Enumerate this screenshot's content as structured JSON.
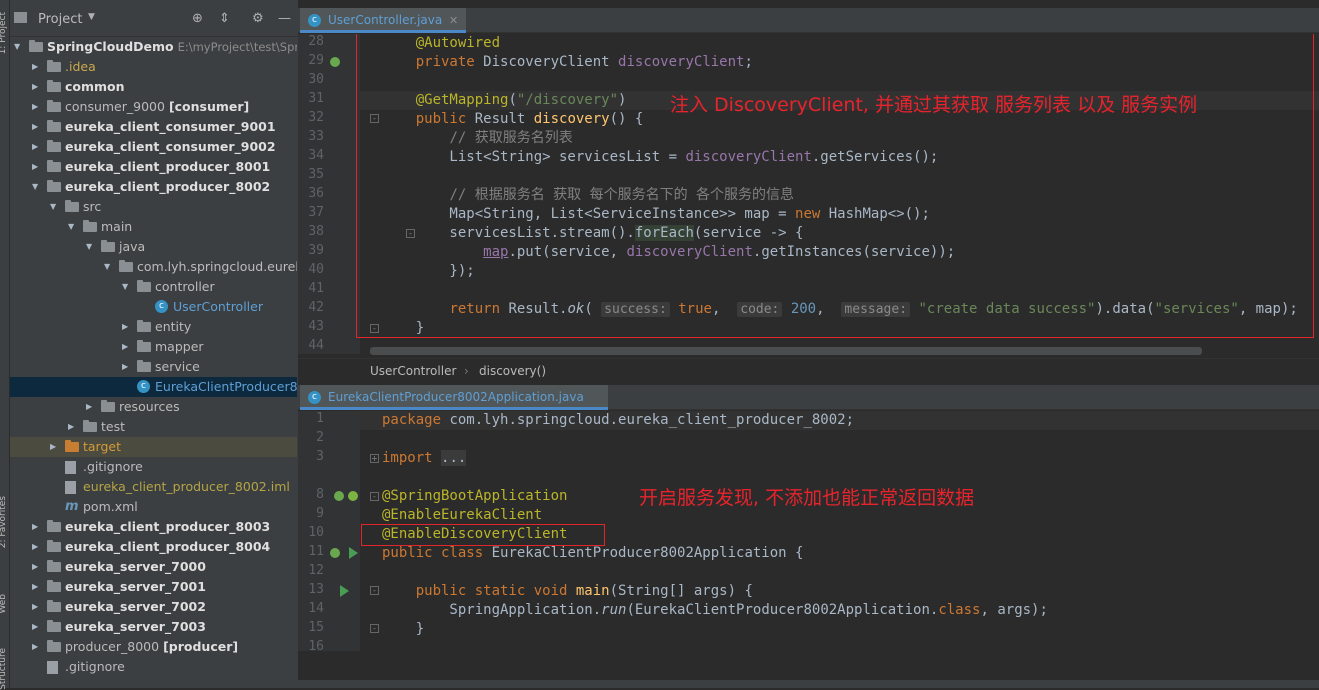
{
  "left_strip": {
    "tabs": [
      "1: Project",
      "2: Favorites",
      "Web",
      "Structure"
    ]
  },
  "project_panel": {
    "title": "Project",
    "tree": [
      {
        "indent": 0,
        "arrow": "▼",
        "icon": "folder",
        "label": "SpringCloudDemo",
        "extra": "E:\\myProject\\test\\Sprin",
        "style": "bold"
      },
      {
        "indent": 1,
        "arrow": "▶",
        "icon": "folder",
        "label": ".idea",
        "style": "idea"
      },
      {
        "indent": 1,
        "arrow": "▶",
        "icon": "folder",
        "label": "common",
        "style": "bold"
      },
      {
        "indent": 1,
        "arrow": "▶",
        "icon": "folder",
        "label": "consumer_9000",
        "tag": "[consumer]",
        "style": "normal"
      },
      {
        "indent": 1,
        "arrow": "▶",
        "icon": "folder",
        "label": "eureka_client_consumer_9001",
        "style": "bold"
      },
      {
        "indent": 1,
        "arrow": "▶",
        "icon": "folder",
        "label": "eureka_client_consumer_9002",
        "style": "bold"
      },
      {
        "indent": 1,
        "arrow": "▶",
        "icon": "folder",
        "label": "eureka_client_producer_8001",
        "style": "bold"
      },
      {
        "indent": 1,
        "arrow": "▼",
        "icon": "folder",
        "label": "eureka_client_producer_8002",
        "style": "bold"
      },
      {
        "indent": 2,
        "arrow": "▼",
        "icon": "folder",
        "label": "src",
        "style": "normal"
      },
      {
        "indent": 3,
        "arrow": "▼",
        "icon": "folder",
        "label": "main",
        "style": "normal"
      },
      {
        "indent": 4,
        "arrow": "▼",
        "icon": "folder",
        "label": "java",
        "style": "normal"
      },
      {
        "indent": 5,
        "arrow": "▼",
        "icon": "folder",
        "label": "com.lyh.springcloud.eureka_",
        "style": "normal"
      },
      {
        "indent": 6,
        "arrow": "▼",
        "icon": "folder",
        "label": "controller",
        "style": "normal"
      },
      {
        "indent": 7,
        "arrow": "",
        "icon": "class",
        "label": "UserController",
        "style": "blue"
      },
      {
        "indent": 6,
        "arrow": "▶",
        "icon": "folder",
        "label": "entity",
        "style": "normal"
      },
      {
        "indent": 6,
        "arrow": "▶",
        "icon": "folder",
        "label": "mapper",
        "style": "normal"
      },
      {
        "indent": 6,
        "arrow": "▶",
        "icon": "folder",
        "label": "service",
        "style": "normal"
      },
      {
        "indent": 6,
        "arrow": "",
        "icon": "class",
        "label": "EurekaClientProducer800",
        "style": "blue",
        "selected": true
      },
      {
        "indent": 4,
        "arrow": "▶",
        "icon": "folder",
        "label": "resources",
        "style": "normal"
      },
      {
        "indent": 3,
        "arrow": "▶",
        "icon": "folder",
        "label": "test",
        "style": "normal"
      },
      {
        "indent": 2,
        "arrow": "▶",
        "icon": "folder-orange",
        "label": "target",
        "style": "orange",
        "gray": true
      },
      {
        "indent": 2,
        "arrow": "",
        "icon": "file",
        "label": ".gitignore",
        "style": "normal"
      },
      {
        "indent": 2,
        "arrow": "",
        "icon": "file",
        "label": "eureka_client_producer_8002.iml",
        "style": "yellow"
      },
      {
        "indent": 2,
        "arrow": "",
        "icon": "maven",
        "label": "pom.xml",
        "style": "normal"
      },
      {
        "indent": 1,
        "arrow": "▶",
        "icon": "folder",
        "label": "eureka_client_producer_8003",
        "style": "bold"
      },
      {
        "indent": 1,
        "arrow": "▶",
        "icon": "folder",
        "label": "eureka_client_producer_8004",
        "style": "bold"
      },
      {
        "indent": 1,
        "arrow": "▶",
        "icon": "folder",
        "label": "eureka_server_7000",
        "style": "bold"
      },
      {
        "indent": 1,
        "arrow": "▶",
        "icon": "folder",
        "label": "eureka_server_7001",
        "style": "bold"
      },
      {
        "indent": 1,
        "arrow": "▶",
        "icon": "folder",
        "label": "eureka_server_7002",
        "style": "bold"
      },
      {
        "indent": 1,
        "arrow": "▶",
        "icon": "folder",
        "label": "eureka_server_7003",
        "style": "bold"
      },
      {
        "indent": 1,
        "arrow": "▶",
        "icon": "folder",
        "label": "producer_8000",
        "tag": "[producer]",
        "style": "normal"
      },
      {
        "indent": 1,
        "arrow": "",
        "icon": "file",
        "label": ".gitignore",
        "style": "normal"
      }
    ]
  },
  "editor_top": {
    "tab_label": "UserController.java",
    "line_numbers": [
      "28",
      "29",
      "30",
      "31",
      "32",
      "33",
      "34",
      "35",
      "36",
      "37",
      "38",
      "39",
      "40",
      "41",
      "42",
      "43",
      "44"
    ],
    "annotation_note": "注入 DiscoveryClient,  并通过其获取 服务列表 以及 服务实例",
    "breadcrumb": [
      "UserController",
      "discovery()"
    ]
  },
  "editor_bottom": {
    "tab_label": "EurekaClientProducer8002Application.java",
    "line_numbers": [
      "1",
      "2",
      "3",
      "8",
      "9",
      "10",
      "11",
      "12",
      "13",
      "14",
      "15",
      "16"
    ],
    "annotation_note": "开启服务发现,  不添加也能正常返回数据"
  },
  "colors": {
    "accent": "#4a88c7",
    "highlight_red": "#e0262b"
  },
  "icons": [
    "locate-icon",
    "collapse-icon",
    "gear-icon",
    "minimize-icon",
    "class-icon",
    "close-icon",
    "spring-bean-icon",
    "run-icon",
    "fold-icon"
  ]
}
